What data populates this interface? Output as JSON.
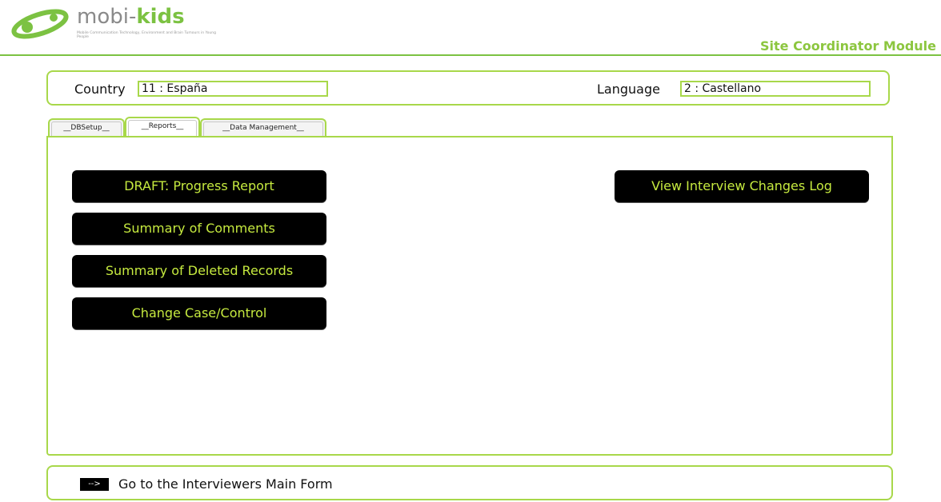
{
  "header": {
    "logo_prefix": "mobi-",
    "logo_brand": "kids",
    "logo_tagline": "Mobile Communication Technology, Environment and Brain Tumours in Young People",
    "module_title": "Site Coordinator Module"
  },
  "location": {
    "country_label": "Country",
    "country_value": "11 : España",
    "language_label": "Language",
    "language_value": "2 : Castellano"
  },
  "tabs": [
    {
      "label": "__DBSetup__"
    },
    {
      "label": "__Reports__"
    },
    {
      "label": "__Data Management__"
    }
  ],
  "reports": {
    "progress_report": "DRAFT: Progress Report",
    "summary_comments": "Summary of Comments",
    "summary_deleted": "Summary of Deleted Records",
    "change_case_control": "Change Case/Control",
    "view_changes_log": "View Interview Changes Log"
  },
  "footer": {
    "arrow": "-->",
    "go_label": "Go to the Interviewers Main Form"
  },
  "colors": {
    "accent_green": "#a8d84a",
    "button_text": "#c6ea3f",
    "brand_green": "#7cc242"
  }
}
